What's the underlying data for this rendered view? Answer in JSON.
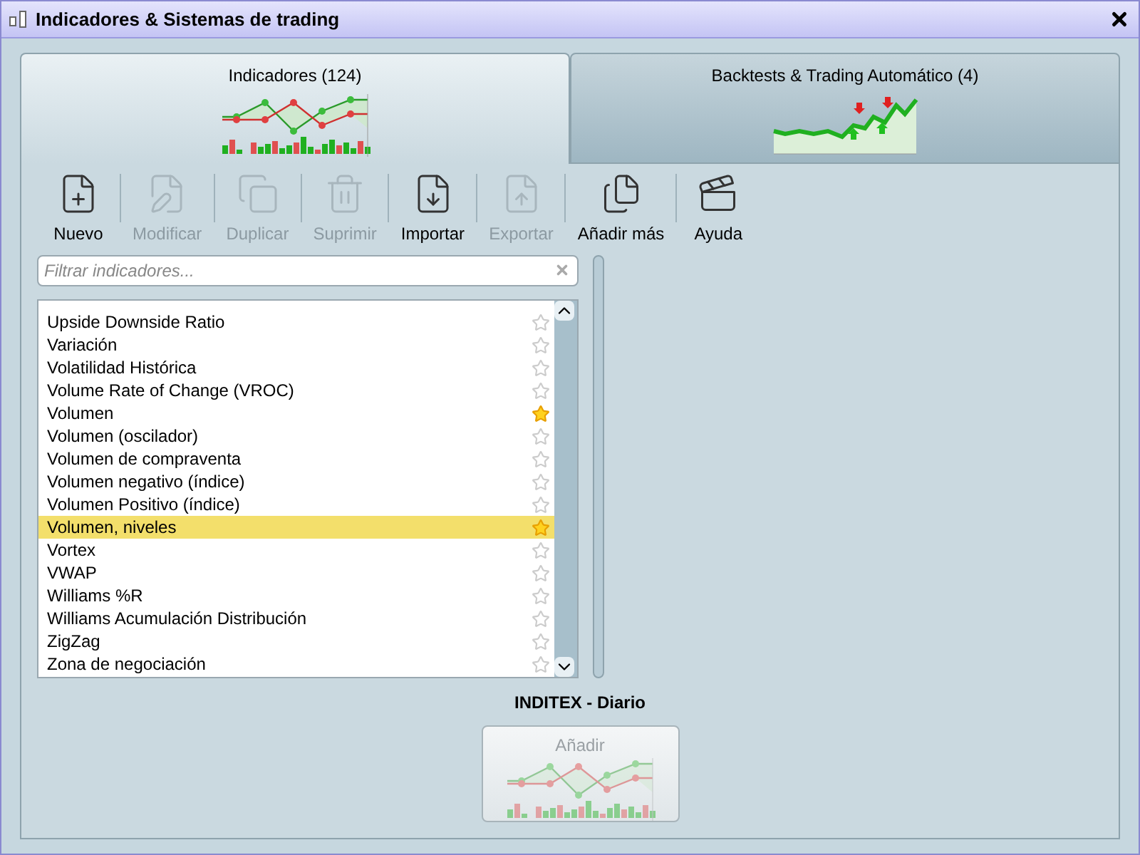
{
  "window": {
    "title": "Indicadores & Sistemas de trading"
  },
  "tabs": [
    {
      "label": "Indicadores (124)",
      "selected": true
    },
    {
      "label": "Backtests & Trading Automático (4)",
      "selected": false
    }
  ],
  "toolbar": [
    {
      "label": "Nuevo",
      "disabled": false
    },
    {
      "label": "Modificar",
      "disabled": true
    },
    {
      "label": "Duplicar",
      "disabled": true
    },
    {
      "label": "Suprimir",
      "disabled": true
    },
    {
      "label": "Importar",
      "disabled": false
    },
    {
      "label": "Exportar",
      "disabled": true
    },
    {
      "label": "Añadir más",
      "disabled": false
    },
    {
      "label": "Ayuda",
      "disabled": false
    }
  ],
  "search": {
    "placeholder": "Filtrar indicadores..."
  },
  "indicators": [
    {
      "label": "Upside Downside Ratio",
      "starred": false,
      "selected": false
    },
    {
      "label": "Variación",
      "starred": false,
      "selected": false
    },
    {
      "label": "Volatilidad Histórica",
      "starred": false,
      "selected": false
    },
    {
      "label": "Volume Rate of Change (VROC)",
      "starred": false,
      "selected": false
    },
    {
      "label": "Volumen",
      "starred": true,
      "selected": false
    },
    {
      "label": "Volumen (oscilador)",
      "starred": false,
      "selected": false
    },
    {
      "label": "Volumen de compraventa",
      "starred": false,
      "selected": false
    },
    {
      "label": "Volumen negativo (índice)",
      "starred": false,
      "selected": false
    },
    {
      "label": "Volumen Positivo (índice)",
      "starred": false,
      "selected": false
    },
    {
      "label": "Volumen, niveles",
      "starred": true,
      "selected": true
    },
    {
      "label": "Vortex",
      "starred": false,
      "selected": false
    },
    {
      "label": "VWAP",
      "starred": false,
      "selected": false
    },
    {
      "label": "Williams %R",
      "starred": false,
      "selected": false
    },
    {
      "label": "Williams Acumulación Distribución",
      "starred": false,
      "selected": false
    },
    {
      "label": "ZigZag",
      "starred": false,
      "selected": false
    },
    {
      "label": "Zona de negociación",
      "starred": false,
      "selected": false
    }
  ],
  "chart_context": {
    "label": "INDITEX - Diario"
  },
  "add_button": {
    "label": "Añadir",
    "disabled": true
  }
}
